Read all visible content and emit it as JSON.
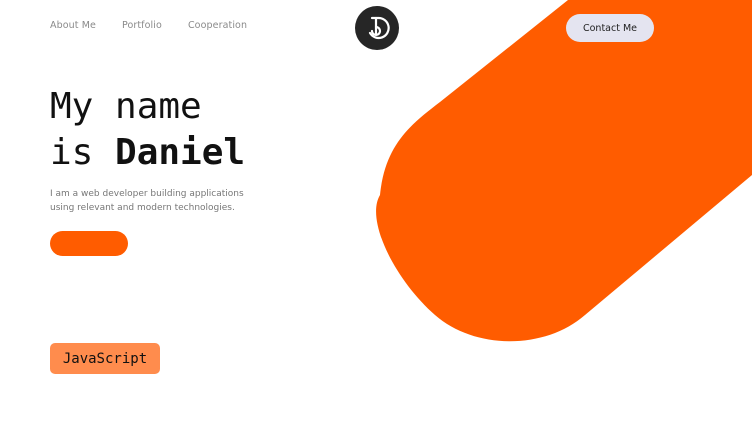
{
  "nav": {
    "items": [
      {
        "label": "About Me"
      },
      {
        "label": "Portfolio"
      },
      {
        "label": "Cooperation"
      }
    ]
  },
  "header": {
    "logo_icon": "letter-d-logo-icon",
    "contact_label": "Contact Me"
  },
  "hero": {
    "title_line1": "My name",
    "title_prefix": "is ",
    "title_name": "Daniel",
    "description": "I am a web developer building applications using relevant and modern technologies.",
    "cta_label": ""
  },
  "skills": {
    "current": "JavaScript"
  },
  "colors": {
    "accent": "#ff5c00",
    "badge": "#ff8c4d",
    "logo_bg": "#262626",
    "contact_bg": "#e4e4f0"
  }
}
